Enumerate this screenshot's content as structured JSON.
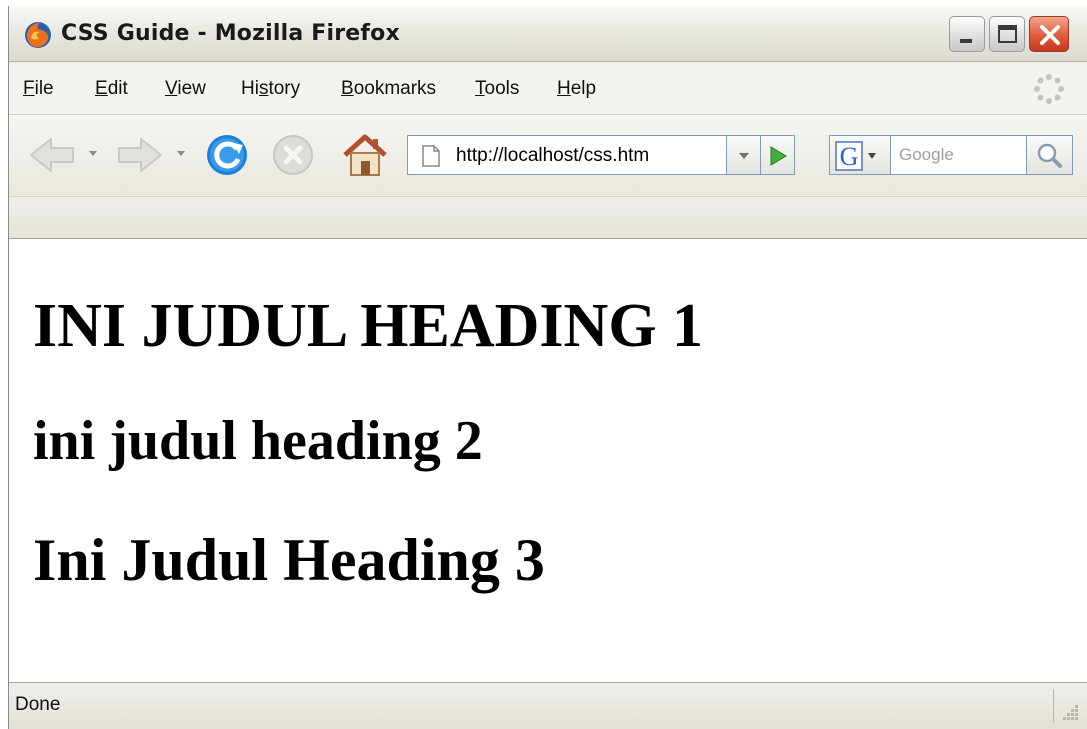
{
  "window": {
    "title": "CSS Guide - Mozilla Firefox"
  },
  "menu": {
    "items": [
      {
        "label_key": "F",
        "label_rest": "ile"
      },
      {
        "label_key": "E",
        "label_rest": "dit"
      },
      {
        "label_key": "V",
        "label_rest": "iew"
      },
      {
        "label_pre": "Hi",
        "label_key": "s",
        "label_rest": "tory"
      },
      {
        "label_key": "B",
        "label_rest": "ookmarks"
      },
      {
        "label_key": "T",
        "label_rest": "ools"
      },
      {
        "label_key": "H",
        "label_rest": "elp"
      }
    ]
  },
  "toolbar": {
    "url": "http://localhost/css.htm",
    "search_placeholder": "Google",
    "search_engine_icon": "google-g-icon"
  },
  "page": {
    "heading1": "INI JUDUL HEADING 1",
    "heading2": "ini judul heading 2",
    "heading3": "Ini Judul Heading 3"
  },
  "status": {
    "text": "Done"
  },
  "colors": {
    "content_bg": "#ffffff",
    "chrome_bg": "#ece9d8",
    "close_button": "#e05a3c",
    "go_arrow": "#3fae3a",
    "reload_blue": "#1e7fd6"
  }
}
